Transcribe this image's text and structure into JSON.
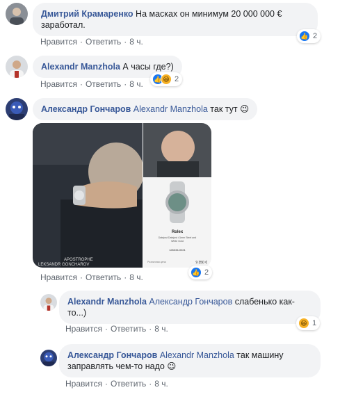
{
  "comments": [
    {
      "author": "Дмитрий Крамаренко",
      "text": "На масках он минимум 20 000 000 € заработал.",
      "reaction_count": "2",
      "reaction_types": [
        "like"
      ],
      "like_label": "Нравится",
      "reply_label": "Ответить",
      "time": "8 ч."
    },
    {
      "author": "Alexandr Manzhola",
      "text": "А часы где?)",
      "reaction_count": "2",
      "reaction_types": [
        "like",
        "haha"
      ],
      "like_label": "Нравится",
      "reply_label": "Ответить",
      "time": "8 ч."
    },
    {
      "author": "Александр Гончаров",
      "mention": "Alexandr Manzhola",
      "text": "так тут 😉",
      "reaction_count": "2",
      "reaction_types": [
        "like"
      ],
      "like_label": "Нравится",
      "reply_label": "Ответить",
      "time": "8 ч.",
      "photo_left_watermark": "APOSTROPHE\nLEKSANDR GONCHAROV",
      "photo_right_brand": "Rolex",
      "photo_right_caption": "Datejust Datejust 41mm Steel and White Gold",
      "photo_right_ref": "126334-0021",
      "photo_right_price_label": "Розничная цена",
      "photo_right_price": "9 350 €"
    },
    {
      "author": "Alexandr Manzhola",
      "mention": "Александр Гончаров",
      "text": "слабенько как-то...)",
      "reaction_count": "1",
      "reaction_types": [
        "haha"
      ],
      "like_label": "Нравится",
      "reply_label": "Ответить",
      "time": "8 ч."
    },
    {
      "author": "Александр Гончаров",
      "mention": "Alexandr Manzhola",
      "text": "так машину заправлять чем-то надо 😉",
      "like_label": "Нравится",
      "reply_label": "Ответить",
      "time": "8 ч."
    }
  ],
  "colors": {
    "link": "#385898",
    "bubble": "#f2f3f5",
    "meta": "#606770",
    "like_blue": "#1877f2",
    "haha_yellow": "#f7b125"
  },
  "icons": [
    "like-reaction-icon",
    "haha-reaction-icon"
  ]
}
